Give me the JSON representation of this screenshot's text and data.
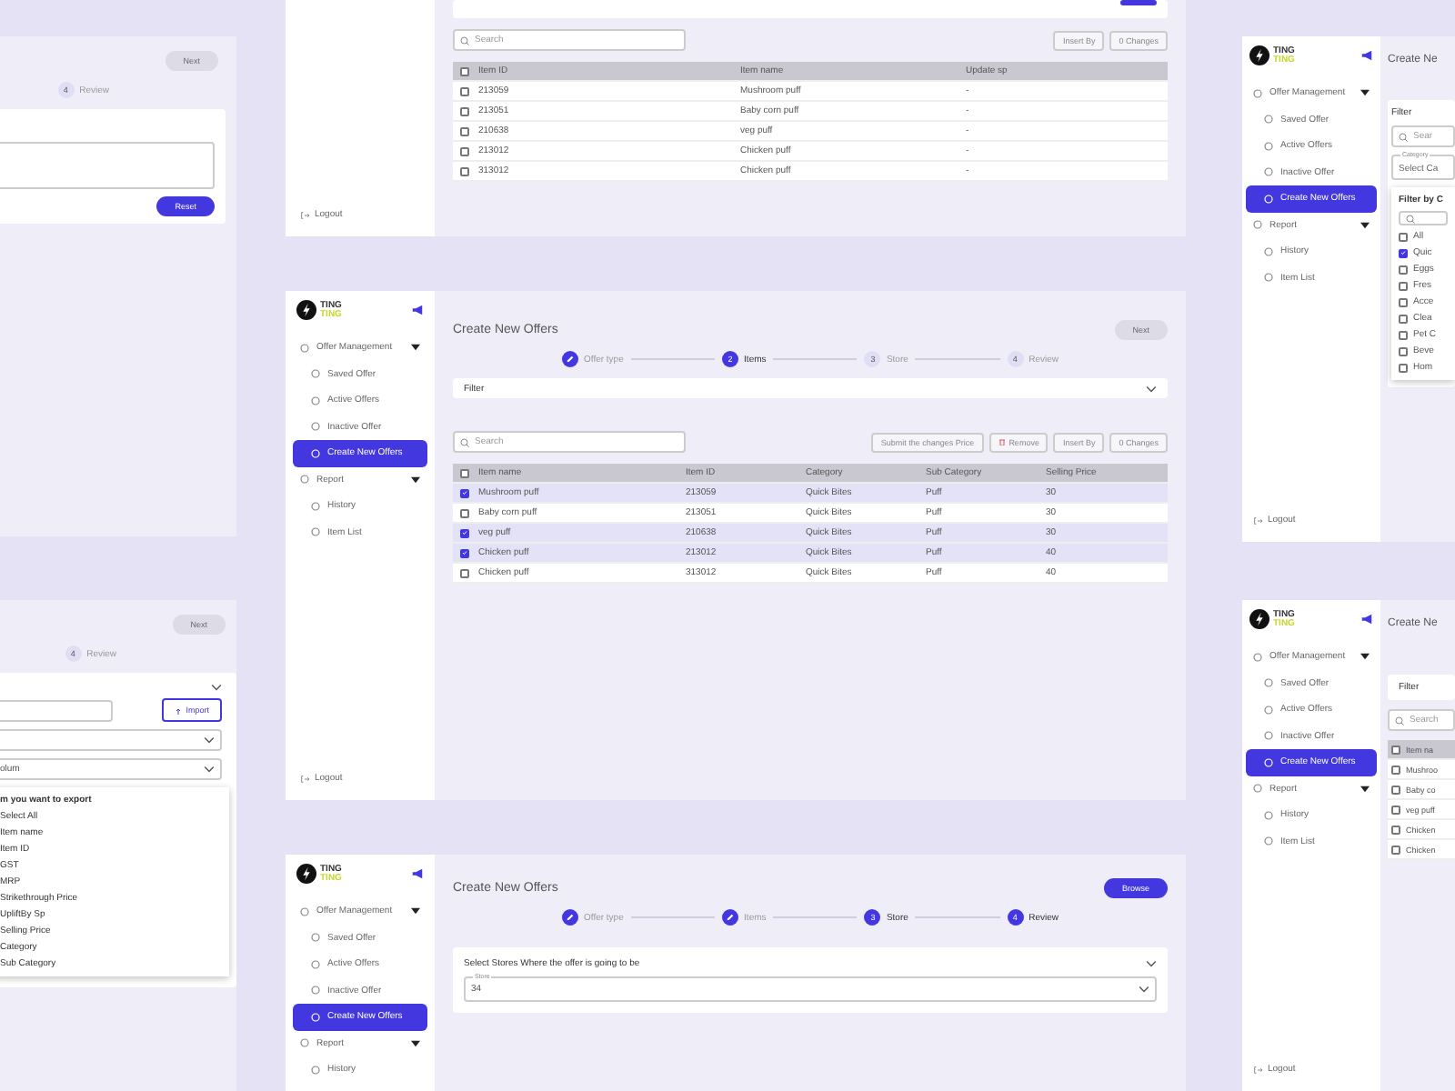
{
  "top_left_panel": {
    "next_button": "Next",
    "step": {
      "number": "4",
      "label": "Review"
    },
    "reset_button": "Reset"
  },
  "top_panel": {
    "sidebar": {
      "logout": "Logout"
    },
    "search": {
      "placeholder": "Search"
    },
    "buttons": [
      "Insert By",
      "0 Changes"
    ],
    "table": {
      "all_checked": false,
      "columns": [
        "Item ID",
        "Item name",
        "Update sp"
      ],
      "rows": [
        {
          "checked": false,
          "cells": [
            "213059",
            "Mushroom puff",
            "-"
          ]
        },
        {
          "checked": false,
          "cells": [
            "213051",
            "Baby corn puff",
            "-"
          ]
        },
        {
          "checked": false,
          "cells": [
            "210638",
            "veg puff",
            "-"
          ]
        },
        {
          "checked": false,
          "cells": [
            "213012",
            "Chicken puff",
            "-"
          ]
        },
        {
          "checked": false,
          "cells": [
            "313012",
            "Chicken puff",
            "-"
          ]
        }
      ]
    }
  },
  "top_right_panel": {
    "sidebar": {
      "logo": [
        "TING",
        "TING"
      ],
      "items": [
        {
          "kind": "section",
          "label": "Offer Management",
          "selected": false
        },
        {
          "kind": "link",
          "label": "Saved Offer",
          "selected": false
        },
        {
          "kind": "link",
          "label": "Active Offers",
          "selected": false
        },
        {
          "kind": "link",
          "label": "Inactive Offer",
          "selected": false
        },
        {
          "kind": "link",
          "label": "Create New Offers",
          "selected": true
        },
        {
          "kind": "section",
          "label": "Report",
          "selected": false
        },
        {
          "kind": "link",
          "label": "History",
          "selected": false
        },
        {
          "kind": "link",
          "label": "Item List",
          "selected": false
        }
      ],
      "logout": "Logout"
    },
    "title": "Create Ne",
    "filter_label": "Filter",
    "search": {
      "placeholder": "Sear"
    },
    "category": {
      "label": "Category",
      "value": "Select Ca"
    },
    "popup": {
      "title": "Filter by C",
      "options": [
        {
          "label": "All",
          "checked": false
        },
        {
          "label": "Quic",
          "checked": true
        },
        {
          "label": "Eggs",
          "checked": false
        },
        {
          "label": "Fres",
          "checked": false
        },
        {
          "label": "Acce",
          "checked": false
        },
        {
          "label": "Clea",
          "checked": false
        },
        {
          "label": "Pet C",
          "checked": false
        },
        {
          "label": "Beve",
          "checked": false
        },
        {
          "label": "Hom",
          "checked": false
        }
      ]
    }
  },
  "middle_left_panel": {
    "next_button": "Next",
    "step": {
      "number": "4",
      "label": "Review"
    },
    "import_button": "Import",
    "select_value": "olum",
    "export_list": {
      "title": "m you want to export",
      "options": [
        "Select All",
        "Item name",
        "Item ID",
        "GST",
        "MRP",
        "Strikethrough Price",
        "UpliftBy Sp",
        "Selling Price",
        "Category",
        "Sub Category"
      ]
    }
  },
  "main_panel": {
    "sidebar": {
      "logo": [
        "TING",
        "TING"
      ],
      "items": [
        {
          "kind": "section",
          "label": "Offer Management",
          "selected": false
        },
        {
          "kind": "link",
          "label": "Saved Offer",
          "selected": false
        },
        {
          "kind": "link",
          "label": "Active Offers",
          "selected": false
        },
        {
          "kind": "link",
          "label": "Inactive Offer",
          "selected": false
        },
        {
          "kind": "link",
          "label": "Create New Offers",
          "selected": true
        },
        {
          "kind": "section",
          "label": "Report",
          "selected": false
        },
        {
          "kind": "link",
          "label": "History",
          "selected": false
        },
        {
          "kind": "link",
          "label": "Item List",
          "selected": false
        }
      ],
      "logout": "Logout"
    },
    "title": "Create New Offers",
    "next_button": "Next",
    "steps": [
      {
        "label": "Offer type",
        "completed": true,
        "active": false
      },
      {
        "number": "2",
        "label": "Items",
        "completed": false,
        "active": true
      },
      {
        "number": "3",
        "label": "Store",
        "completed": false,
        "active": false
      },
      {
        "number": "4",
        "label": "Review",
        "completed": false,
        "active": false
      }
    ],
    "filter_label": "Filter",
    "search": {
      "placeholder": "Search"
    },
    "buttons": [
      "Submit the changes Price",
      "Remove",
      "Insert By",
      "0 Changes"
    ],
    "table": {
      "all_checked": false,
      "columns": [
        "Item name",
        "Item ID",
        "Category",
        "Sub Category",
        "Selling Price"
      ],
      "rows": [
        {
          "checked": true,
          "cells": [
            "Mushroom puff",
            "213059",
            "Quick Bites",
            "Puff",
            "30"
          ]
        },
        {
          "checked": false,
          "cells": [
            "Baby corn puff",
            "213051",
            "Quick Bites",
            "Puff",
            "30"
          ]
        },
        {
          "checked": true,
          "cells": [
            "veg puff",
            "210638",
            "Quick Bites",
            "Puff",
            "30"
          ]
        },
        {
          "checked": true,
          "cells": [
            "Chicken puff",
            "213012",
            "Quick Bites",
            "Puff",
            "40"
          ]
        },
        {
          "checked": false,
          "cells": [
            "Chicken puff",
            "313012",
            "Quick Bites",
            "Puff",
            "40"
          ]
        }
      ]
    }
  },
  "middle_right_panel": {
    "sidebar": {
      "logo": [
        "TING",
        "TING"
      ],
      "items": [
        {
          "kind": "section",
          "label": "Offer Management",
          "selected": false
        },
        {
          "kind": "link",
          "label": "Saved Offer",
          "selected": false
        },
        {
          "kind": "link",
          "label": "Active Offers",
          "selected": false
        },
        {
          "kind": "link",
          "label": "Inactive Offer",
          "selected": false
        },
        {
          "kind": "link",
          "label": "Create New Offers",
          "selected": true
        },
        {
          "kind": "section",
          "label": "Report",
          "selected": false
        },
        {
          "kind": "link",
          "label": "History",
          "selected": false
        },
        {
          "kind": "link",
          "label": "Item List",
          "selected": false
        }
      ],
      "logout": "Logout"
    },
    "title": "Create Ne",
    "filter_label": "Filter",
    "search": {
      "placeholder": "Search"
    },
    "table": {
      "all_checked": false,
      "columns": [
        "Item na"
      ],
      "rows": [
        {
          "checked": false,
          "cells": [
            "Mushroo"
          ]
        },
        {
          "checked": false,
          "cells": [
            "Baby co"
          ]
        },
        {
          "checked": false,
          "cells": [
            "veg puff"
          ]
        },
        {
          "checked": false,
          "cells": [
            "Chicken"
          ]
        },
        {
          "checked": false,
          "cells": [
            "Chicken"
          ]
        }
      ]
    }
  },
  "bottom_panel": {
    "sidebar": {
      "logo": [
        "TING",
        "TING"
      ],
      "items": [
        {
          "kind": "section",
          "label": "Offer Management",
          "selected": false
        },
        {
          "kind": "link",
          "label": "Saved Offer",
          "selected": false
        },
        {
          "kind": "link",
          "label": "Active Offers",
          "selected": false
        },
        {
          "kind": "link",
          "label": "Inactive Offer",
          "selected": false
        },
        {
          "kind": "link",
          "label": "Create New Offers",
          "selected": true
        },
        {
          "kind": "section",
          "label": "Report",
          "selected": false
        },
        {
          "kind": "link",
          "label": "History",
          "selected": false
        }
      ]
    },
    "title": "Create New Offers",
    "browse_button": "Browse",
    "steps": [
      {
        "label": "Offer type",
        "completed": true,
        "active": false
      },
      {
        "label": "Items",
        "completed": true,
        "active": false
      },
      {
        "number": "3",
        "label": "Store",
        "completed": false,
        "active": true
      },
      {
        "number": "4",
        "label": "Review",
        "completed": false,
        "active": true
      }
    ],
    "section_title": "Select Stores Where the offer is going to be",
    "store_field": {
      "label": "Store",
      "value": "34"
    }
  }
}
